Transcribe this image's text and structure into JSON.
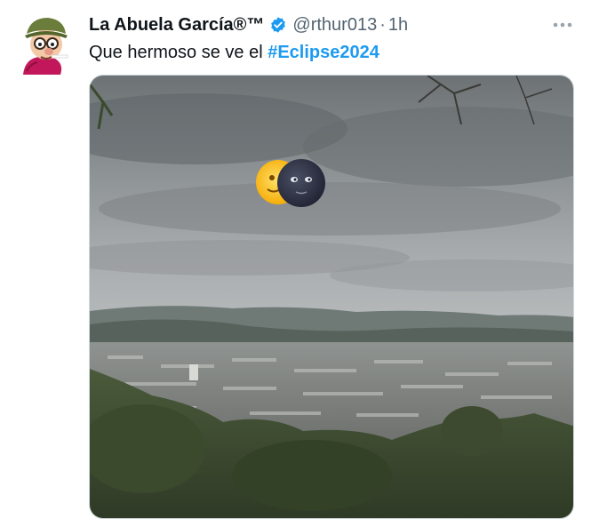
{
  "tweet": {
    "author_name": "La Abuela García®™",
    "verified_icon": "verified-badge-icon",
    "handle": "@rthur013",
    "separator": "·",
    "time": "1h",
    "text_prefix": "Que hermoso se ve el ",
    "hashtag": "#Eclipse2024",
    "more_icon": "more-options-icon",
    "media_description_icons": [
      "sun-emoji",
      "new-moon-face-emoji"
    ]
  },
  "colors": {
    "text": "#0f1419",
    "secondary": "#536471",
    "link": "#1d9bf0",
    "verified": "#1d9bf0"
  }
}
